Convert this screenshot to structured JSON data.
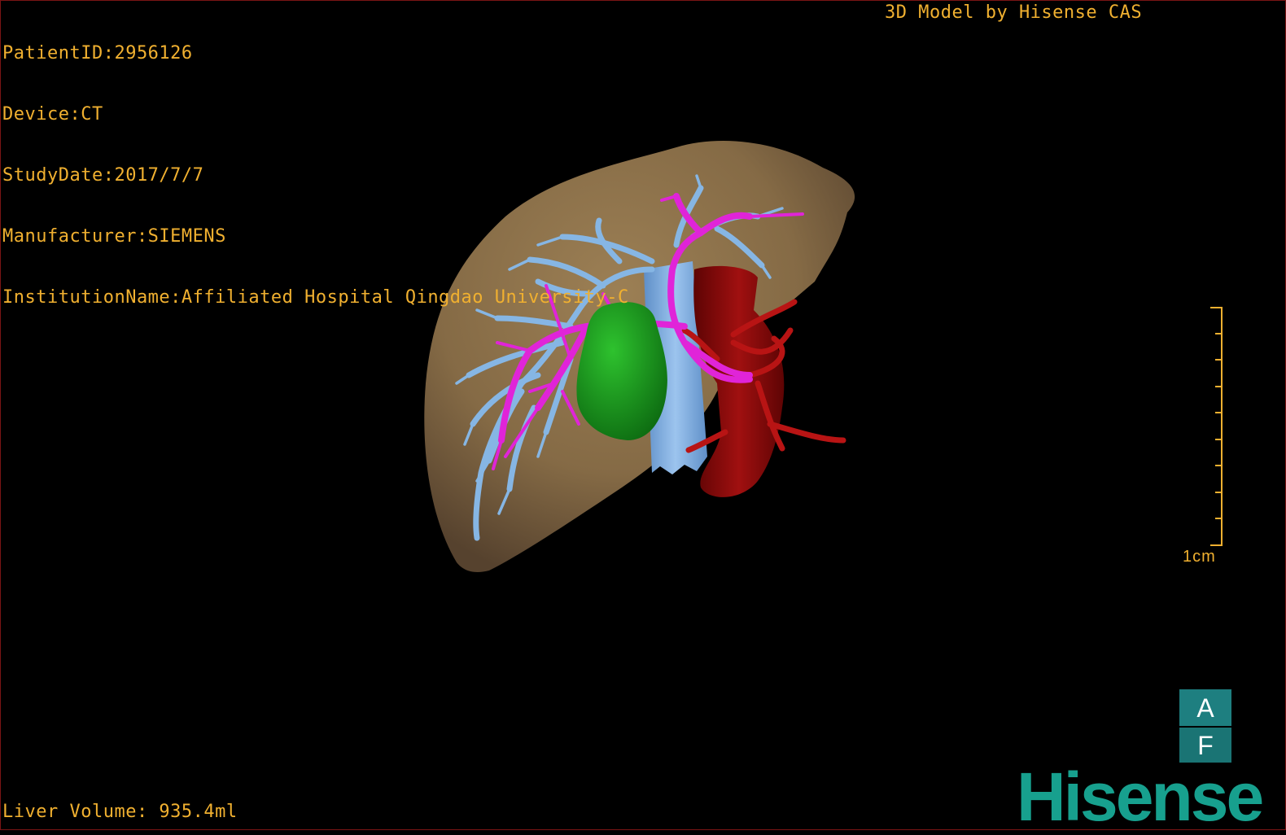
{
  "overlay": {
    "patient_id": "PatientID:2956126",
    "device": "Device:CT",
    "study_date": "StudyDate:2017/7/7",
    "manufacturer": "Manufacturer:SIEMENS",
    "institution": "InstitutionName:Affiliated Hospital Qingdao University-C",
    "credit": "3D Model by Hisense CAS",
    "liver_volume": "Liver Volume: 935.4ml"
  },
  "scale": {
    "label": "1cm"
  },
  "orientation": {
    "top": "A",
    "bottom": "F"
  },
  "brand": {
    "logo_text": "Hisense"
  },
  "colors": {
    "overlay_text": "#f0b030",
    "liver": "#8c7049",
    "hepatic_vein": "#7fb2e0",
    "portal_vein": "#e020d8",
    "tumor": "#1a9a20",
    "aorta": "#8a0a0a",
    "logo": "#17a08e",
    "orientation_cube": "#1e7f80"
  }
}
